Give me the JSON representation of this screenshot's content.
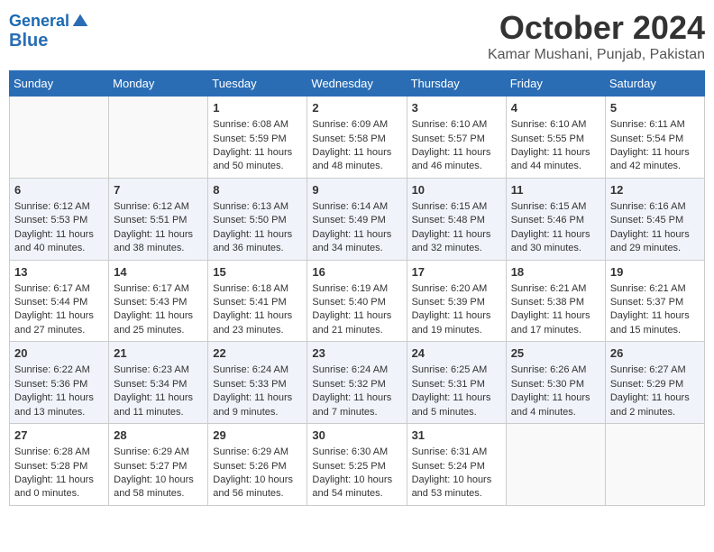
{
  "header": {
    "logo_line1": "General",
    "logo_line2": "Blue",
    "month": "October 2024",
    "location": "Kamar Mushani, Punjab, Pakistan"
  },
  "weekdays": [
    "Sunday",
    "Monday",
    "Tuesday",
    "Wednesday",
    "Thursday",
    "Friday",
    "Saturday"
  ],
  "weeks": [
    [
      {
        "day": "",
        "sunrise": "",
        "sunset": "",
        "daylight": ""
      },
      {
        "day": "",
        "sunrise": "",
        "sunset": "",
        "daylight": ""
      },
      {
        "day": "1",
        "sunrise": "Sunrise: 6:08 AM",
        "sunset": "Sunset: 5:59 PM",
        "daylight": "Daylight: 11 hours and 50 minutes."
      },
      {
        "day": "2",
        "sunrise": "Sunrise: 6:09 AM",
        "sunset": "Sunset: 5:58 PM",
        "daylight": "Daylight: 11 hours and 48 minutes."
      },
      {
        "day": "3",
        "sunrise": "Sunrise: 6:10 AM",
        "sunset": "Sunset: 5:57 PM",
        "daylight": "Daylight: 11 hours and 46 minutes."
      },
      {
        "day": "4",
        "sunrise": "Sunrise: 6:10 AM",
        "sunset": "Sunset: 5:55 PM",
        "daylight": "Daylight: 11 hours and 44 minutes."
      },
      {
        "day": "5",
        "sunrise": "Sunrise: 6:11 AM",
        "sunset": "Sunset: 5:54 PM",
        "daylight": "Daylight: 11 hours and 42 minutes."
      }
    ],
    [
      {
        "day": "6",
        "sunrise": "Sunrise: 6:12 AM",
        "sunset": "Sunset: 5:53 PM",
        "daylight": "Daylight: 11 hours and 40 minutes."
      },
      {
        "day": "7",
        "sunrise": "Sunrise: 6:12 AM",
        "sunset": "Sunset: 5:51 PM",
        "daylight": "Daylight: 11 hours and 38 minutes."
      },
      {
        "day": "8",
        "sunrise": "Sunrise: 6:13 AM",
        "sunset": "Sunset: 5:50 PM",
        "daylight": "Daylight: 11 hours and 36 minutes."
      },
      {
        "day": "9",
        "sunrise": "Sunrise: 6:14 AM",
        "sunset": "Sunset: 5:49 PM",
        "daylight": "Daylight: 11 hours and 34 minutes."
      },
      {
        "day": "10",
        "sunrise": "Sunrise: 6:15 AM",
        "sunset": "Sunset: 5:48 PM",
        "daylight": "Daylight: 11 hours and 32 minutes."
      },
      {
        "day": "11",
        "sunrise": "Sunrise: 6:15 AM",
        "sunset": "Sunset: 5:46 PM",
        "daylight": "Daylight: 11 hours and 30 minutes."
      },
      {
        "day": "12",
        "sunrise": "Sunrise: 6:16 AM",
        "sunset": "Sunset: 5:45 PM",
        "daylight": "Daylight: 11 hours and 29 minutes."
      }
    ],
    [
      {
        "day": "13",
        "sunrise": "Sunrise: 6:17 AM",
        "sunset": "Sunset: 5:44 PM",
        "daylight": "Daylight: 11 hours and 27 minutes."
      },
      {
        "day": "14",
        "sunrise": "Sunrise: 6:17 AM",
        "sunset": "Sunset: 5:43 PM",
        "daylight": "Daylight: 11 hours and 25 minutes."
      },
      {
        "day": "15",
        "sunrise": "Sunrise: 6:18 AM",
        "sunset": "Sunset: 5:41 PM",
        "daylight": "Daylight: 11 hours and 23 minutes."
      },
      {
        "day": "16",
        "sunrise": "Sunrise: 6:19 AM",
        "sunset": "Sunset: 5:40 PM",
        "daylight": "Daylight: 11 hours and 21 minutes."
      },
      {
        "day": "17",
        "sunrise": "Sunrise: 6:20 AM",
        "sunset": "Sunset: 5:39 PM",
        "daylight": "Daylight: 11 hours and 19 minutes."
      },
      {
        "day": "18",
        "sunrise": "Sunrise: 6:21 AM",
        "sunset": "Sunset: 5:38 PM",
        "daylight": "Daylight: 11 hours and 17 minutes."
      },
      {
        "day": "19",
        "sunrise": "Sunrise: 6:21 AM",
        "sunset": "Sunset: 5:37 PM",
        "daylight": "Daylight: 11 hours and 15 minutes."
      }
    ],
    [
      {
        "day": "20",
        "sunrise": "Sunrise: 6:22 AM",
        "sunset": "Sunset: 5:36 PM",
        "daylight": "Daylight: 11 hours and 13 minutes."
      },
      {
        "day": "21",
        "sunrise": "Sunrise: 6:23 AM",
        "sunset": "Sunset: 5:34 PM",
        "daylight": "Daylight: 11 hours and 11 minutes."
      },
      {
        "day": "22",
        "sunrise": "Sunrise: 6:24 AM",
        "sunset": "Sunset: 5:33 PM",
        "daylight": "Daylight: 11 hours and 9 minutes."
      },
      {
        "day": "23",
        "sunrise": "Sunrise: 6:24 AM",
        "sunset": "Sunset: 5:32 PM",
        "daylight": "Daylight: 11 hours and 7 minutes."
      },
      {
        "day": "24",
        "sunrise": "Sunrise: 6:25 AM",
        "sunset": "Sunset: 5:31 PM",
        "daylight": "Daylight: 11 hours and 5 minutes."
      },
      {
        "day": "25",
        "sunrise": "Sunrise: 6:26 AM",
        "sunset": "Sunset: 5:30 PM",
        "daylight": "Daylight: 11 hours and 4 minutes."
      },
      {
        "day": "26",
        "sunrise": "Sunrise: 6:27 AM",
        "sunset": "Sunset: 5:29 PM",
        "daylight": "Daylight: 11 hours and 2 minutes."
      }
    ],
    [
      {
        "day": "27",
        "sunrise": "Sunrise: 6:28 AM",
        "sunset": "Sunset: 5:28 PM",
        "daylight": "Daylight: 11 hours and 0 minutes."
      },
      {
        "day": "28",
        "sunrise": "Sunrise: 6:29 AM",
        "sunset": "Sunset: 5:27 PM",
        "daylight": "Daylight: 10 hours and 58 minutes."
      },
      {
        "day": "29",
        "sunrise": "Sunrise: 6:29 AM",
        "sunset": "Sunset: 5:26 PM",
        "daylight": "Daylight: 10 hours and 56 minutes."
      },
      {
        "day": "30",
        "sunrise": "Sunrise: 6:30 AM",
        "sunset": "Sunset: 5:25 PM",
        "daylight": "Daylight: 10 hours and 54 minutes."
      },
      {
        "day": "31",
        "sunrise": "Sunrise: 6:31 AM",
        "sunset": "Sunset: 5:24 PM",
        "daylight": "Daylight: 10 hours and 53 minutes."
      },
      {
        "day": "",
        "sunrise": "",
        "sunset": "",
        "daylight": ""
      },
      {
        "day": "",
        "sunrise": "",
        "sunset": "",
        "daylight": ""
      }
    ]
  ]
}
